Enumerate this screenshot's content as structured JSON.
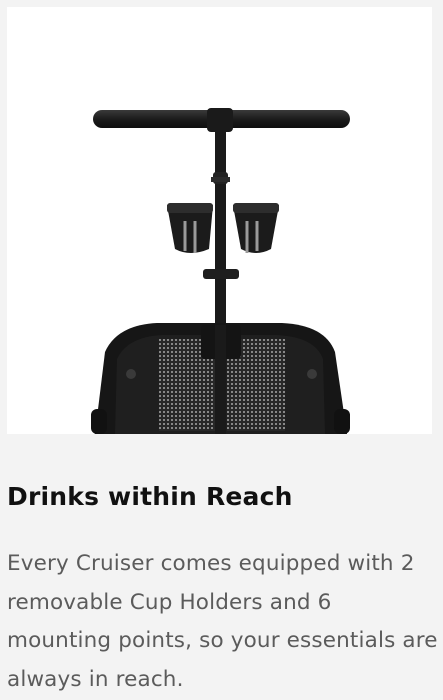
{
  "product_card": {
    "image_alt": "Stroller handlebar with two cup holders",
    "title": "Drinks within Reach",
    "description": "Every Cruiser comes equipped with 2 removable Cup Holders and 6 mounting points, so your essentials are always in reach."
  },
  "colors": {
    "page_background": "#f3f3f3",
    "image_background": "#ffffff",
    "title_text": "#111111",
    "body_text": "#5b5b5b",
    "product_black": "#1c1c1c"
  },
  "icons": [
    "product-photo"
  ]
}
